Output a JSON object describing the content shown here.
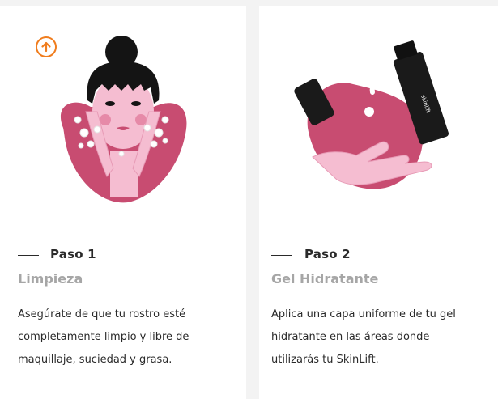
{
  "steps": [
    {
      "label": "Paso 1",
      "title": "Limpieza",
      "description_lines": [
        "Asegúrate de que tu rostro esté",
        "completamente limpio y libre de",
        "maquillaje, suciedad y grasa."
      ],
      "illustration": "face-cleansing-illustration"
    },
    {
      "label": "Paso 2",
      "title": "Gel Hidratante",
      "description_lines": [
        "Aplica una capa uniforme de tu gel",
        "hidratante en las áreas donde",
        "utilizarás tu SkinLift."
      ],
      "illustration": "gel-bottle-hand-illustration",
      "bottle_brand": "skinlift"
    }
  ],
  "scroll_top_icon": "arrow-up-circle-icon",
  "colors": {
    "accent": "#f07d1e",
    "blob": "#c84c71",
    "skin": "#f5bdd1",
    "title_gray": "#a6a6a6",
    "text": "#2a2a2a"
  }
}
